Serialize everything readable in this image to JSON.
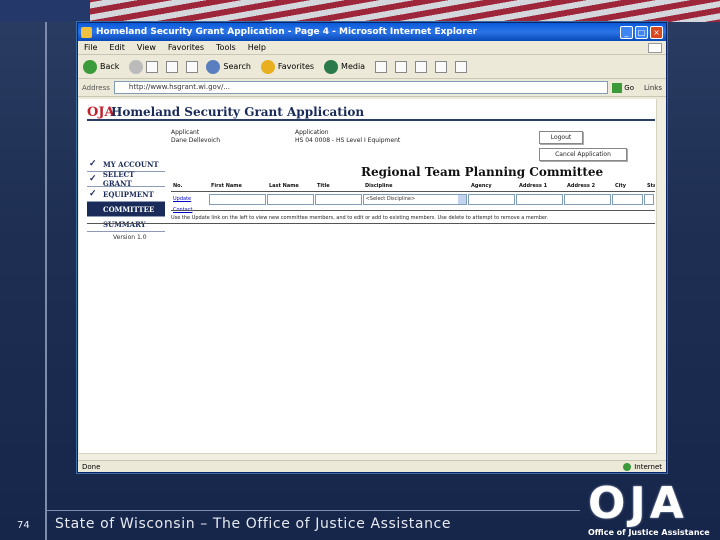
{
  "slide": {
    "page_number": "74",
    "footer": "State of Wisconsin – The Office of Justice Assistance",
    "logo_text": "OJA",
    "logo_subtitle": "Office of Justice Assistance"
  },
  "browser": {
    "title": "Homeland Security Grant Application - Page 4 - Microsoft Internet Explorer",
    "menu": [
      "File",
      "Edit",
      "View",
      "Favorites",
      "Tools",
      "Help"
    ],
    "toolbar": {
      "back": "Back",
      "search": "Search",
      "favorites": "Favorites",
      "media": "Media"
    },
    "address_label": "Address",
    "address_value": "http://www.hsgrant.wi.gov/...",
    "go_label": "Go",
    "links_label": "Links",
    "status_left": "Done",
    "status_right": "Internet"
  },
  "app": {
    "logo": "OJA",
    "title": "Homeland Security Grant Application",
    "applicant_label": "Applicant",
    "applicant_value": "Dane Dellevoich",
    "application_label": "Application",
    "application_value": "HS 04 0008 - HS Level I Equipment",
    "buttons": {
      "logout": "Logout",
      "cancel_application": "Cancel Application"
    },
    "nav": [
      {
        "label": "MY ACCOUNT",
        "checked": true,
        "active": false
      },
      {
        "label": "SELECT GRANT",
        "checked": true,
        "active": false
      },
      {
        "label": "EQUIPMENT",
        "checked": true,
        "active": false
      },
      {
        "label": "COMMITTEE",
        "checked": false,
        "active": true
      },
      {
        "label": "SUMMARY",
        "checked": false,
        "active": false
      }
    ],
    "version": "Version 1.0",
    "section_title": "Regional Team Planning Committee",
    "table": {
      "headers": [
        "No.",
        "First Name",
        "Last Name",
        "Title",
        "Discipline",
        "Agency",
        "Address 1",
        "Address 2",
        "City",
        "State"
      ],
      "row": {
        "link": "Update Contact",
        "select_value": "<Select Discipline>"
      }
    },
    "instructions": "Use the Update link on the left to view new committee members, and to edit or add to existing members. Use delete to attempt to remove a member."
  }
}
